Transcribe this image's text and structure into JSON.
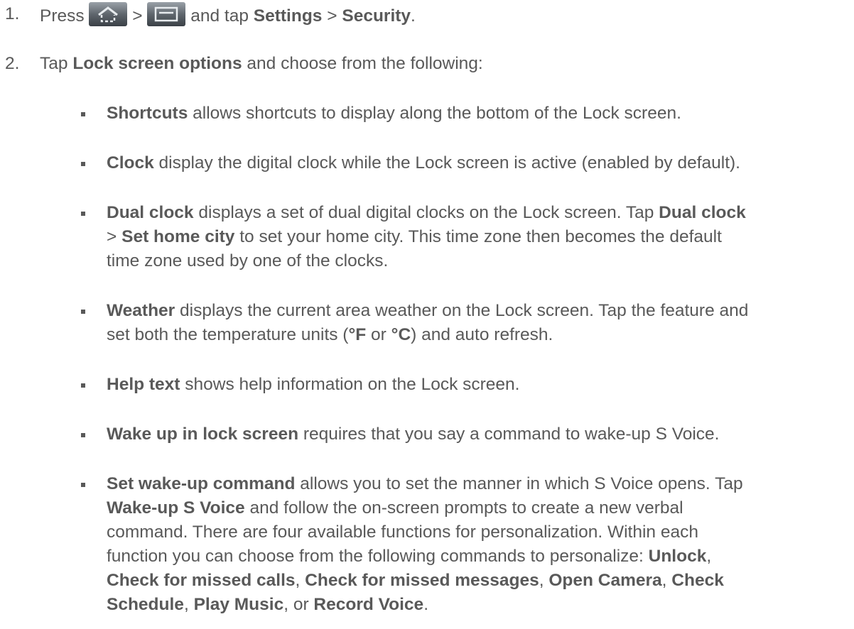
{
  "step1": {
    "number": "1.",
    "press": "Press",
    "sep1": ">",
    "mid": "and tap",
    "settings": "Settings",
    "sep2": ">",
    "security": "Security",
    "end": ".",
    "icons": [
      "home-key-icon",
      "menu-key-icon"
    ]
  },
  "step2": {
    "number": "2.",
    "tap": "Tap",
    "lock_screen_options": "Lock screen options",
    "rest": "and choose from the following:"
  },
  "options": [
    {
      "name": "shortcuts",
      "lines": [
        [
          {
            "t": "Shortcuts",
            "b": true
          },
          {
            "t": " allows shortcuts to display along the bottom of the Lock screen."
          }
        ]
      ]
    },
    {
      "name": "clock",
      "lines": [
        [
          {
            "t": "Clock",
            "b": true
          },
          {
            "t": " display the digital clock while the Lock screen is active (enabled by default)."
          }
        ]
      ]
    },
    {
      "name": "dual-clock",
      "lines": [
        [
          {
            "t": "Dual clock",
            "b": true
          },
          {
            "t": " displays a set of dual digital clocks on the Lock screen. Tap "
          },
          {
            "t": "Dual clock",
            "b": true
          }
        ],
        [
          {
            "t": "> "
          },
          {
            "t": "Set home city",
            "b": true
          },
          {
            "t": "  to set your home city. This time zone then becomes the default"
          }
        ],
        [
          {
            "t": "time zone used by one of the clocks."
          }
        ]
      ]
    },
    {
      "name": "weather",
      "lines": [
        [
          {
            "t": "Weather",
            "b": true
          },
          {
            "t": " displays the current area weather on the Lock screen. Tap the feature and"
          }
        ],
        [
          {
            "t": "set both the temperature units ("
          },
          {
            "t": "°F",
            "b": true
          },
          {
            "t": " or "
          },
          {
            "t": "°C",
            "b": true
          },
          {
            "t": ") and auto refresh."
          }
        ]
      ]
    },
    {
      "name": "help-text",
      "lines": [
        [
          {
            "t": "Help text",
            "b": true
          },
          {
            "t": " shows help information on the Lock screen."
          }
        ]
      ]
    },
    {
      "name": "wake-up-in-lock-screen",
      "lines": [
        [
          {
            "t": "Wake up in lock screen",
            "b": true
          },
          {
            "t": " requires that you say a command to wake-up S Voice."
          }
        ]
      ]
    },
    {
      "name": "set-wake-up-command",
      "lines": [
        [
          {
            "t": "Set wake-up command",
            "b": true
          },
          {
            "t": " allows you to set the manner in which S Voice opens. Tap"
          }
        ],
        [
          {
            "t": "Wake-up S Voice",
            "b": true
          },
          {
            "t": " and follow the on-screen prompts to create a new verbal"
          }
        ],
        [
          {
            "t": "command. There are four available functions for personalization. Within each"
          }
        ],
        [
          {
            "t": "function you can choose from the following commands to personalize: "
          },
          {
            "t": "Unlock",
            "b": true
          },
          {
            "t": ","
          }
        ],
        [
          {
            "t": "Check for missed calls",
            "b": true
          },
          {
            "t": ", "
          },
          {
            "t": "Check for missed messages",
            "b": true
          },
          {
            "t": ", "
          },
          {
            "t": "Open Camera",
            "b": true
          },
          {
            "t": ", "
          },
          {
            "t": "Check",
            "b": true
          }
        ],
        [
          {
            "t": "Schedule",
            "b": true
          },
          {
            "t": ", "
          },
          {
            "t": "Play Music",
            "b": true
          },
          {
            "t": ", or "
          },
          {
            "t": "Record Voice",
            "b": true
          },
          {
            "t": "."
          }
        ]
      ]
    }
  ]
}
